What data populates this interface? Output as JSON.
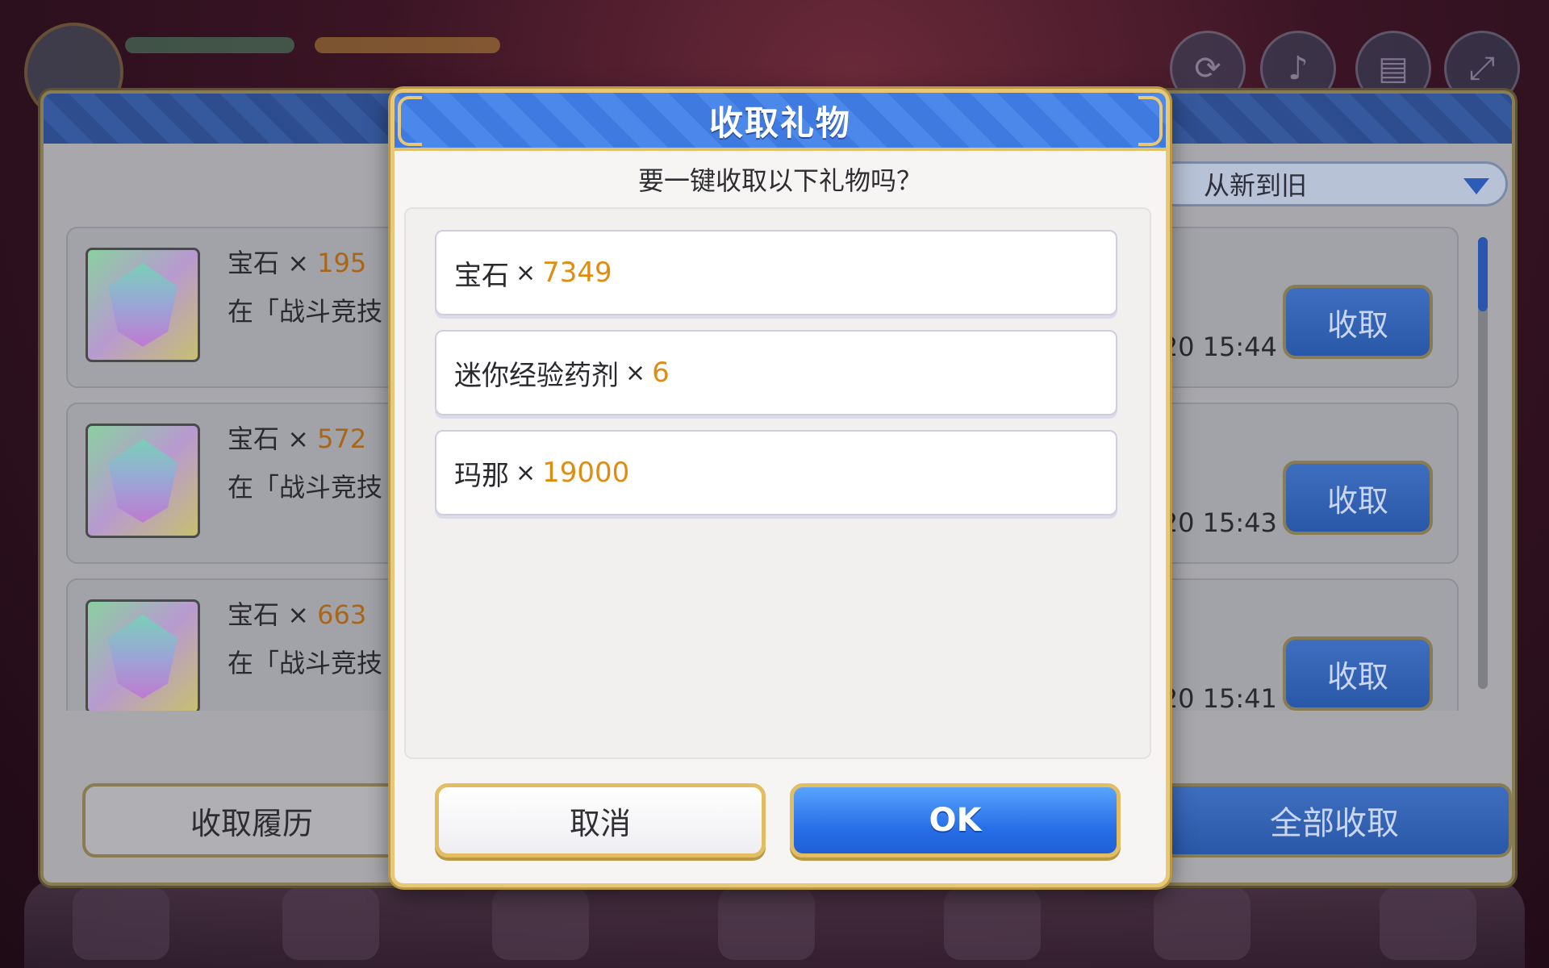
{
  "dialog": {
    "title": "收取礼物",
    "question": "要一键收取以下礼物吗？",
    "items": [
      {
        "name": "宝石",
        "x": "×",
        "count": "7349"
      },
      {
        "name": "迷你经验药剂",
        "x": "×",
        "count": "6"
      },
      {
        "name": "玛那",
        "x": "×",
        "count": "19000"
      }
    ],
    "cancel_label": "取消",
    "ok_label": "OK"
  },
  "gift_list": {
    "sort_label": "从新到旧",
    "rows": [
      {
        "name": "宝石",
        "x": "×",
        "count": "195",
        "desc": "在「战斗竞技",
        "time": "/20 15:44",
        "button": "收取"
      },
      {
        "name": "宝石",
        "x": "×",
        "count": "572",
        "desc": "在「战斗竞技",
        "time": "/20 15:43",
        "button": "收取"
      },
      {
        "name": "宝石",
        "x": "×",
        "count": "663",
        "desc": "在「战斗竞技",
        "time": "/20 15:41",
        "button": "收取"
      }
    ],
    "history_label": "收取履历",
    "collect_all_label": "全部收取"
  },
  "icons": {
    "gift": "gem-icon",
    "sort": "chevron-down-icon",
    "hud": [
      "refresh-icon",
      "music-icon",
      "menu-icon",
      "expand-icon"
    ]
  },
  "colors": {
    "count": "#e08c10",
    "primary": "#2870e8",
    "gold_border": "#e2bd62"
  }
}
